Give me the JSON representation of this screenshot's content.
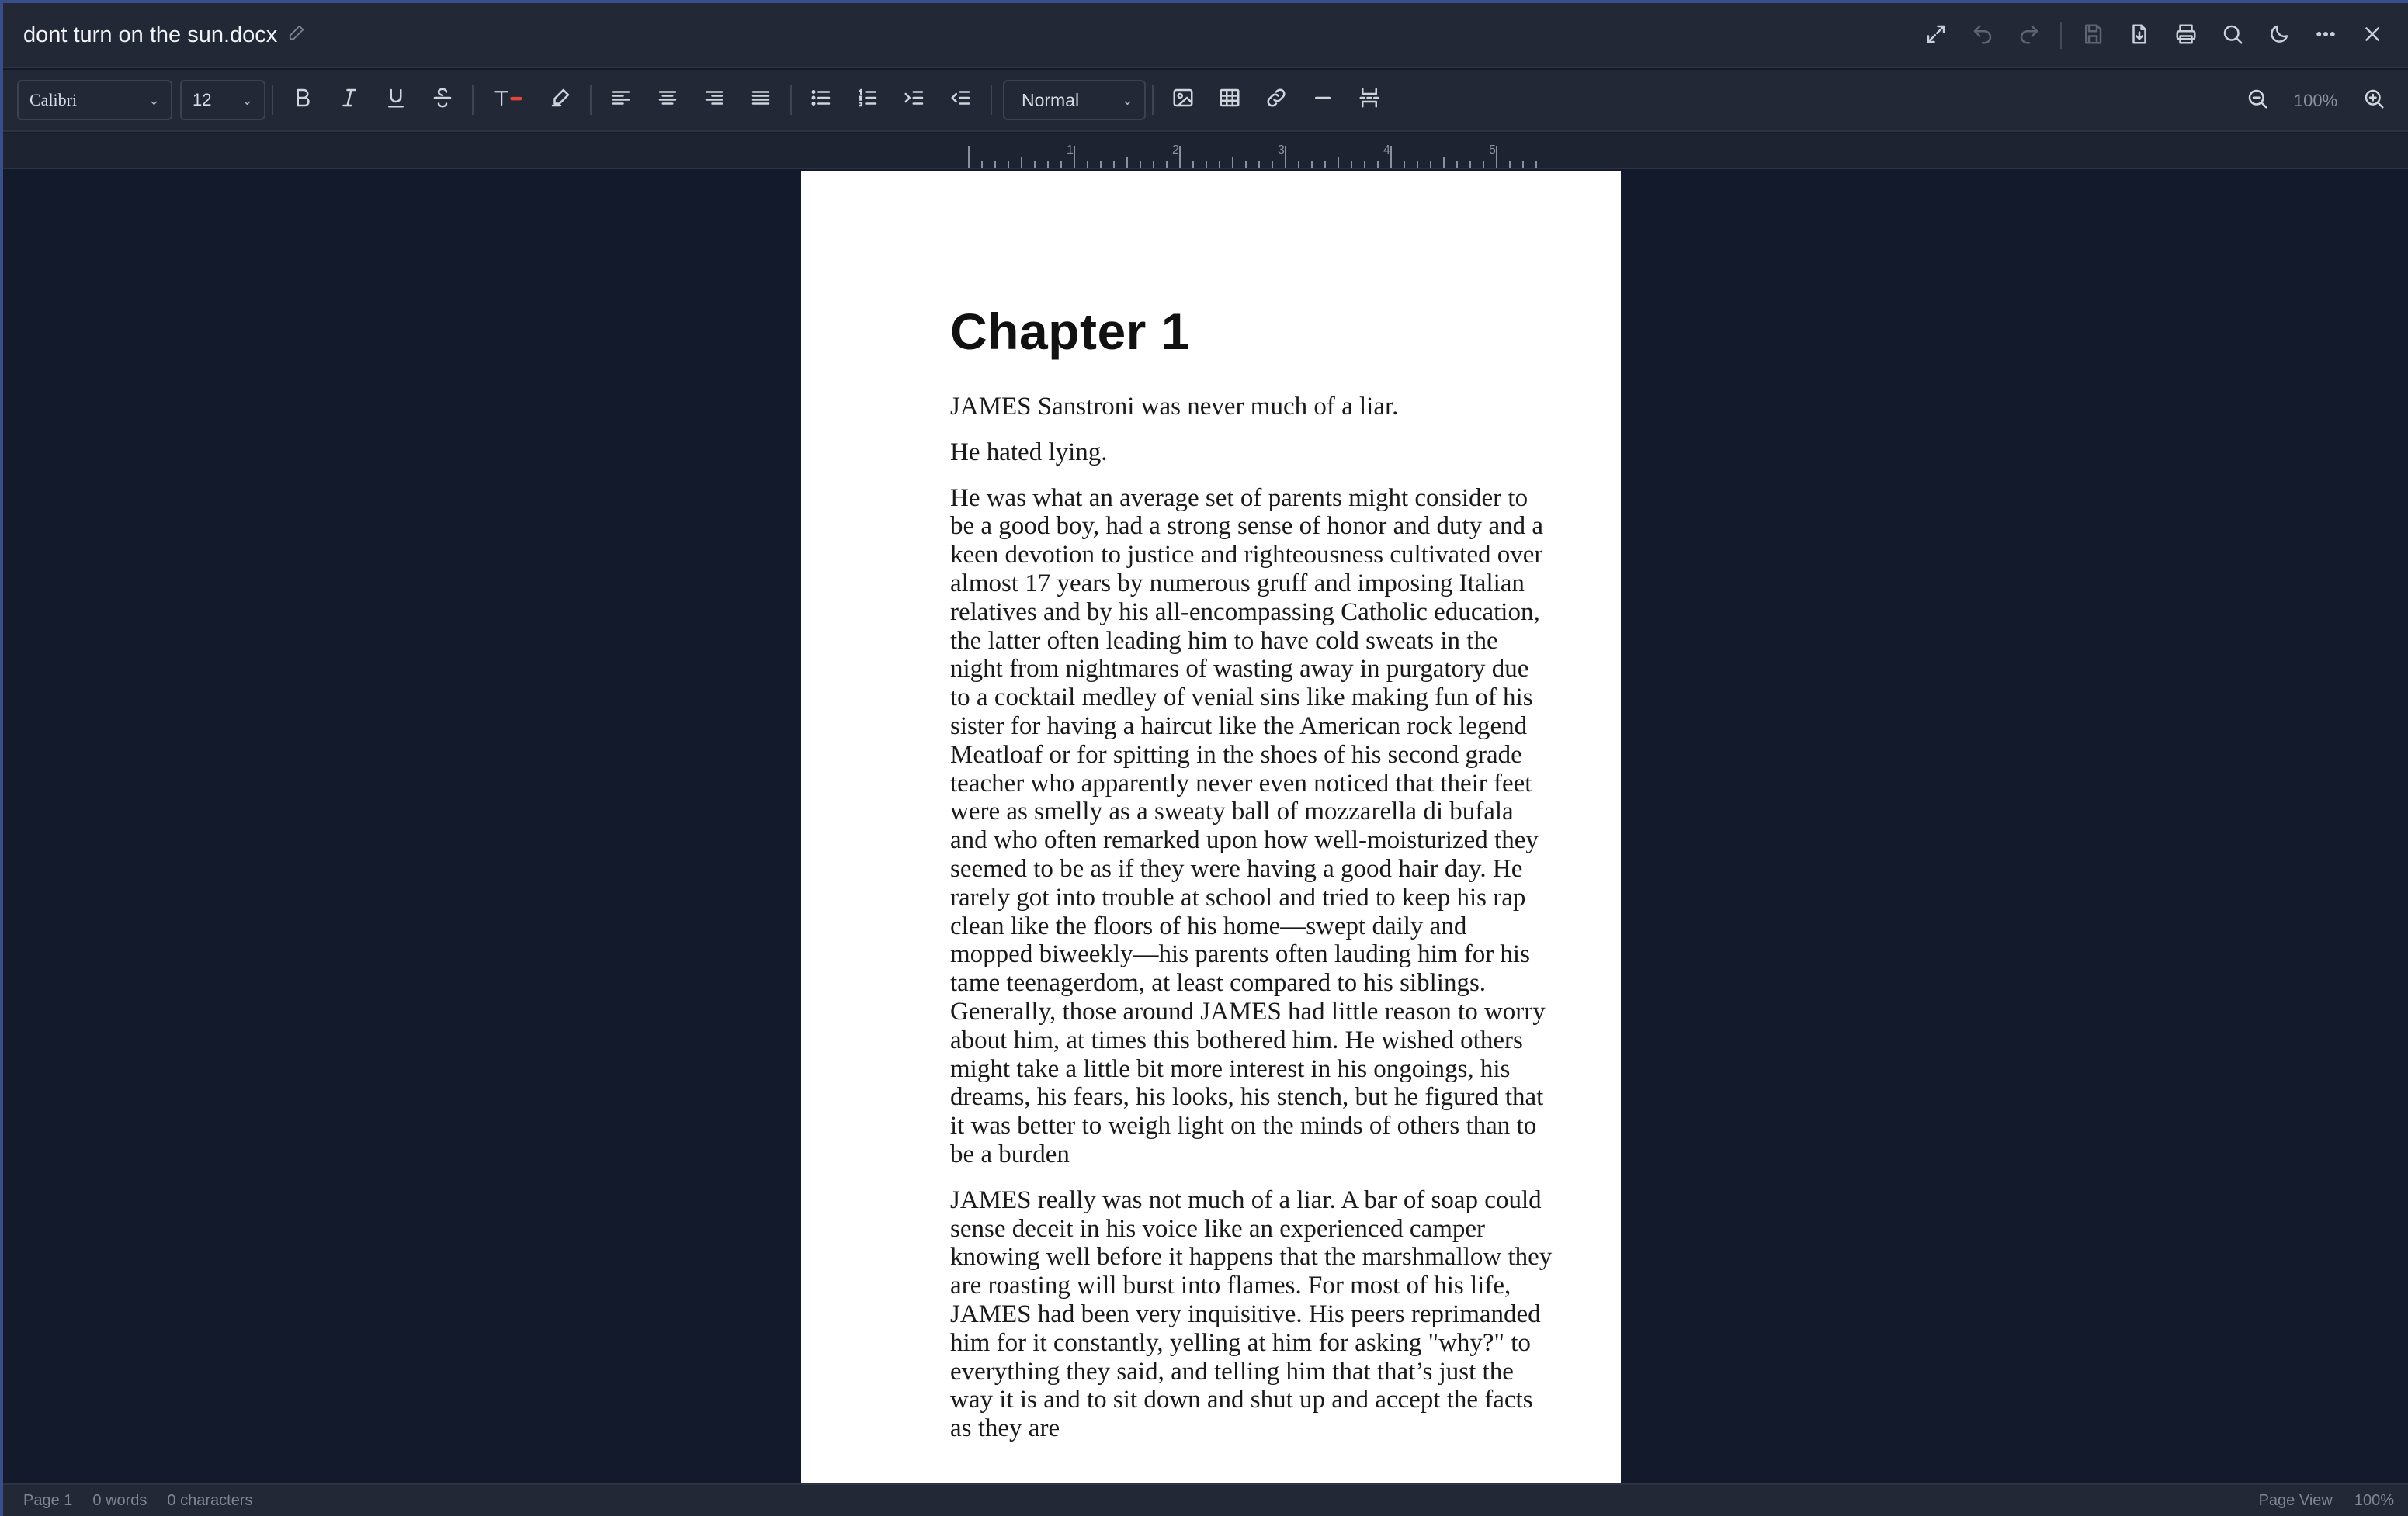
{
  "window": {
    "title": "dont turn on the sun.docx"
  },
  "title_actions": [
    {
      "icon": "expand-icon"
    },
    {
      "icon": "undo-icon"
    },
    {
      "icon": "redo-icon"
    },
    {
      "icon": "save-icon"
    },
    {
      "icon": "download-icon"
    },
    {
      "icon": "print-icon"
    },
    {
      "icon": "search-icon"
    },
    {
      "icon": "moon-icon"
    },
    {
      "icon": "more-icon"
    },
    {
      "icon": "close-icon"
    }
  ],
  "toolbar": {
    "font_family": "Calibri",
    "font_size": "12",
    "paragraph_style": "Normal",
    "zoom": "100%",
    "text_color": "#e0443a"
  },
  "document": {
    "heading": "Chapter 1",
    "paragraphs": [
      "JAMES Sanstroni was never much of a liar.",
      "He hated lying.",
      "He was what an average set of parents might consider to be a good boy, had a strong sense of honor and duty and a keen devotion to justice and righteousness cultivated over almost 17 years by numerous gruff and imposing Italian relatives and by his all-encompassing Catholic education, the latter often leading him to have cold sweats in the night from nightmares of wasting away in purgatory due to a cocktail medley of venial sins like making fun of his sister for having a haircut like the American rock legend Meatloaf or for spitting in the shoes of his second grade teacher who apparently never even noticed that their feet were as smelly as a sweaty ball of mozzarella di bufala and who often remarked upon how well-moisturized they seemed to be as if they were having a good hair day. He rarely got into trouble at school and tried to keep his rap clean like the floors of his home—swept daily and mopped biweekly—his parents often lauding him for his tame teenagerdom, at least compared to his siblings. Generally, those around JAMES had little reason to worry about him, at times this bothered him. He wished others might take a little bit more interest in his ongoings, his dreams, his fears, his looks, his stench, but he figured that it was better to weigh light on the minds of others than to be a burden",
      "JAMES really was not much of a liar. A bar of soap could sense deceit in his voice like an experienced camper knowing well before it happens that the marshmallow they are roasting will burst into flames. For most of his life, JAMES had been very inquisitive. His peers reprimanded him for it constantly, yelling at him for asking \"why?\" to everything they said, and telling him that that’s just the way it is and to sit down and shut up and accept the facts as they are"
    ]
  },
  "status": {
    "page": "Page 1",
    "words": "0 words",
    "characters": "0 characters",
    "view": "Page View",
    "zoom": "100%"
  }
}
